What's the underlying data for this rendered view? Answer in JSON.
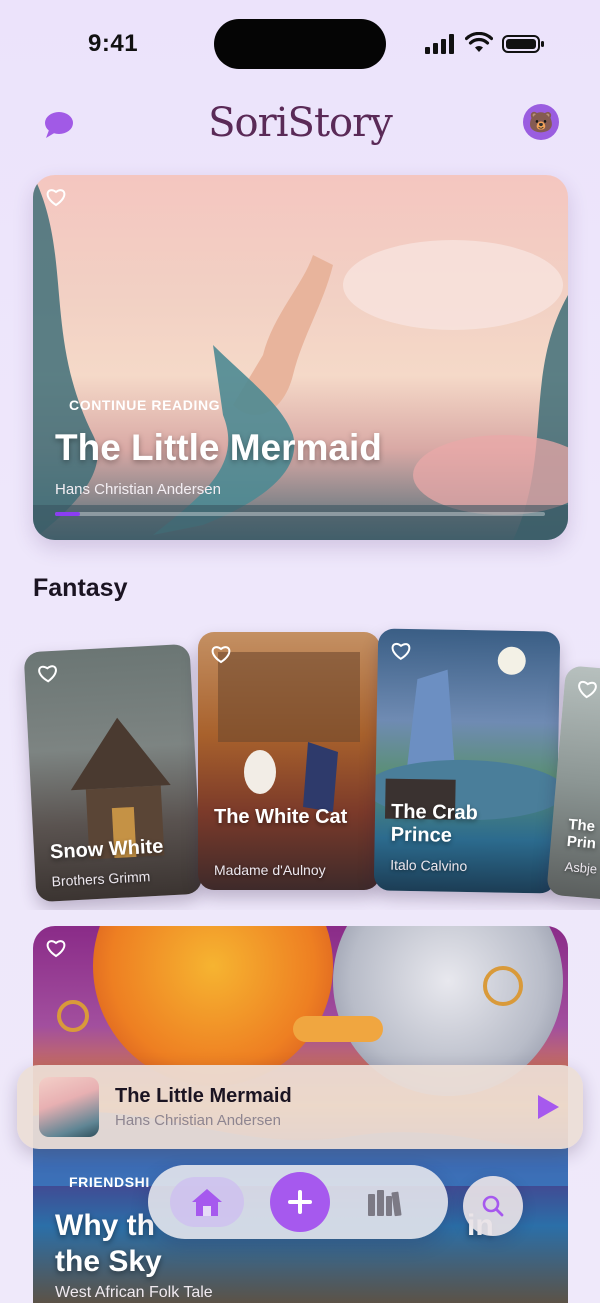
{
  "status_bar": {
    "time": "9:41"
  },
  "header": {
    "logo": "SoriStory",
    "avatar_emoji": "🐻"
  },
  "hero": {
    "label": "CONTINUE READING",
    "title": "The Little Mermaid",
    "author": "Hans Christian Andersen",
    "progress": 0.05
  },
  "section": {
    "title": "Fantasy"
  },
  "books": [
    {
      "title": "Snow White",
      "author": "Brothers Grimm"
    },
    {
      "title": "The White Cat",
      "author": "Madame d'Aulnoy"
    },
    {
      "title": "The Crab Prince",
      "author": "Italo Calvino"
    },
    {
      "title": "The\nPrin",
      "author": "Asbje"
    }
  ],
  "card2": {
    "label": "FRIENDSHI",
    "title": "Why th... in the Sky",
    "title_line1_left": "Why th",
    "title_line1_right": "in",
    "title_line2": "the Sky",
    "author": "West African Folk Tale"
  },
  "mini_player": {
    "title": "The Little Mermaid",
    "author": "Hans Christian Andersen"
  },
  "colors": {
    "accent": "#a659ee",
    "logo": "#5a2a57"
  }
}
